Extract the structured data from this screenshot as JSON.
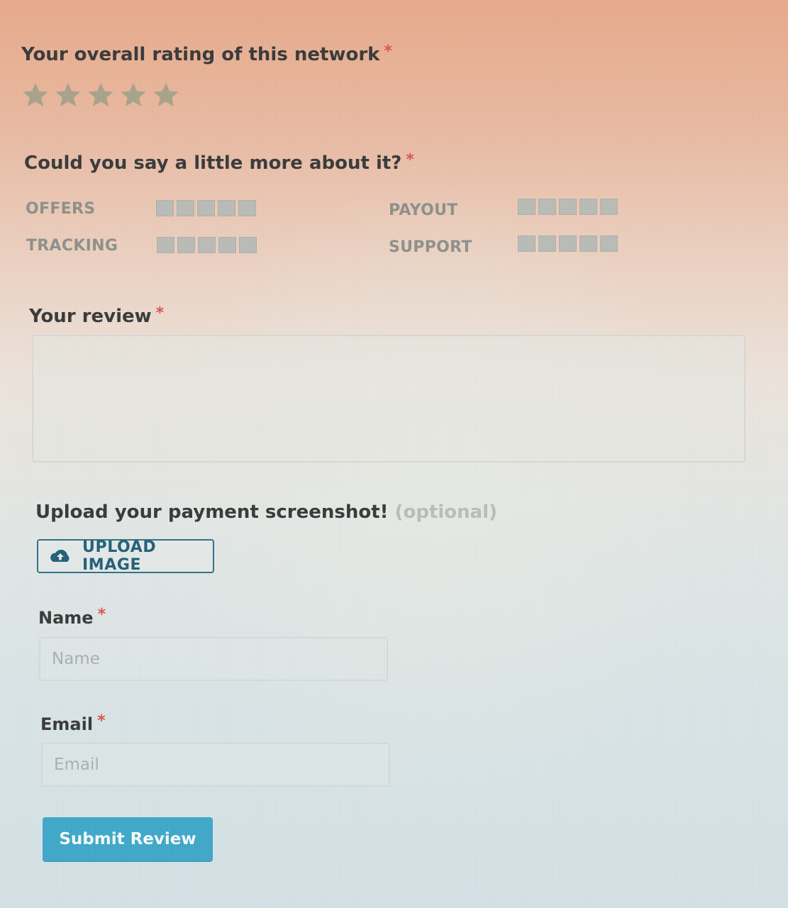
{
  "overall": {
    "label": "Your overall rating of this network",
    "required_mark": "*",
    "stars": {
      "count": 5,
      "selected": 0,
      "icon": "star-icon",
      "color": "#a7a288"
    }
  },
  "details": {
    "label": "Could you say a little more about it?",
    "required_mark": "*",
    "criteria": [
      {
        "label": "OFFERS",
        "boxes": 5,
        "selected": 0
      },
      {
        "label": "PAYOUT",
        "boxes": 5,
        "selected": 0
      },
      {
        "label": "TRACKING",
        "boxes": 5,
        "selected": 0
      },
      {
        "label": "SUPPORT",
        "boxes": 5,
        "selected": 0
      }
    ]
  },
  "review": {
    "label": "Your review",
    "required_mark": "*",
    "value": ""
  },
  "upload": {
    "label": "Upload your payment screenshot!",
    "optional": "(optional)",
    "button_label": "UPLOAD IMAGE",
    "icon": "cloud-upload-icon"
  },
  "name": {
    "label": "Name",
    "required_mark": "*",
    "placeholder": "Name",
    "value": ""
  },
  "email": {
    "label": "Email",
    "required_mark": "*",
    "placeholder": "Email",
    "value": ""
  },
  "submit": {
    "label": "Submit Review",
    "color": "#3ea7c9"
  },
  "colors": {
    "required": "#d9534f",
    "accent": "#205f77"
  }
}
